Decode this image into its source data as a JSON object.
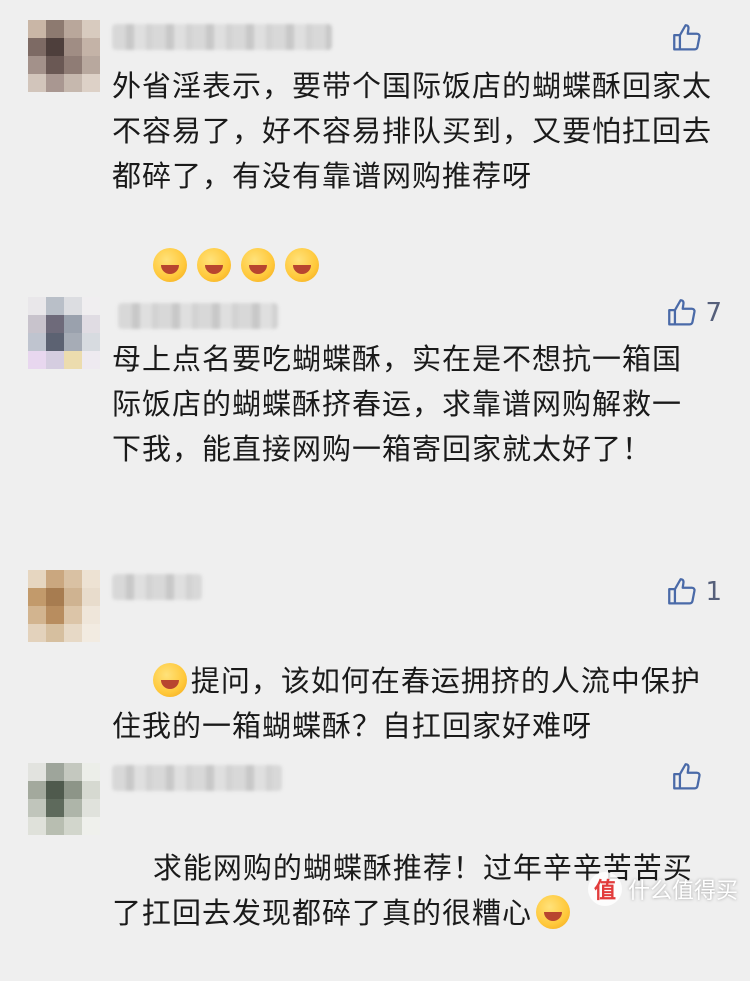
{
  "comments": [
    {
      "text": "外省淫表示，要带个国际饭店的蝴蝶酥回家太不容易了，好不容易排队买到，又要怕扛回去都碎了，有没有靠谱网购推荐呀",
      "emoji_icons": [
        "laugh-cry-icon",
        "laugh-cry-icon",
        "laugh-cry-icon",
        "laugh-cry-icon"
      ],
      "likes": ""
    },
    {
      "text": "母上点名要吃蝴蝶酥，实在是不想抗一箱国际饭店的蝴蝶酥挤春运，求靠谱网购解救一下我，能直接网购一箱寄回家就太好了！",
      "likes": "7"
    },
    {
      "text": "提问，该如何在春运拥挤的人流中保护住我的一箱蝴蝶酥？自扛回家好难呀",
      "lead_icon": "crying-laughing-icon",
      "likes": "1"
    },
    {
      "text": "求能网购的蝴蝶酥推荐！过年辛辛苦苦买了扛回去发现都碎了真的很糟心",
      "trail_icon": "pleading-face-icon",
      "likes": ""
    }
  ],
  "watermark": {
    "badge": "值",
    "text": "什么值得买"
  },
  "colors": {
    "like_icon": "#4a6aa8",
    "background": "#efefef"
  }
}
